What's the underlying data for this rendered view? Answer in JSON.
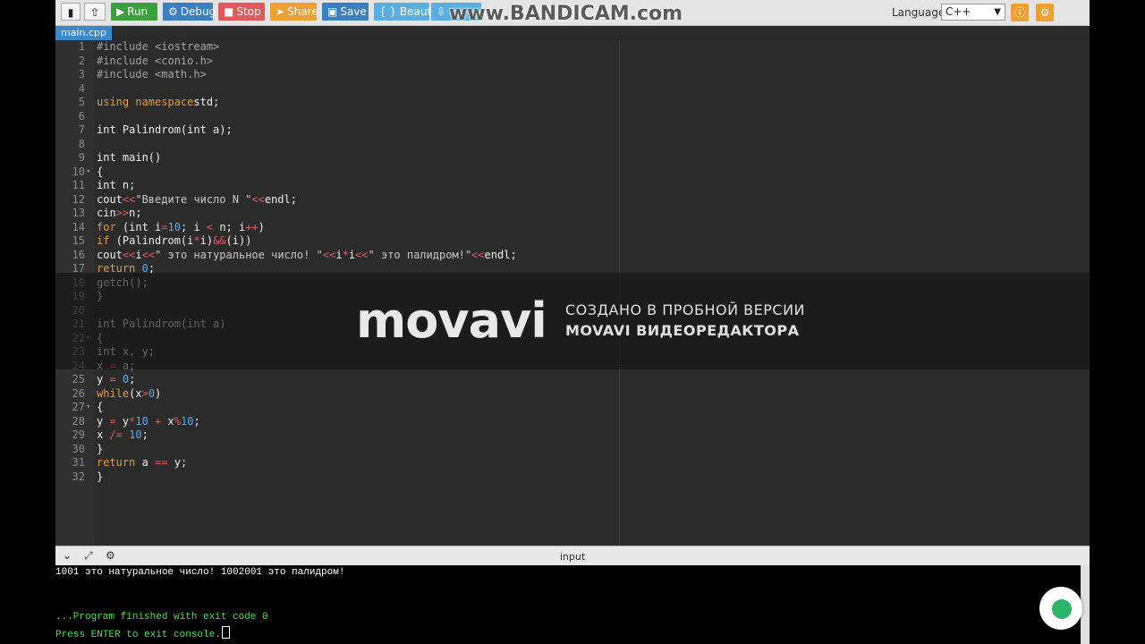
{
  "toolbar": {
    "run": "Run",
    "debug": "Debug",
    "stop": "Stop",
    "share": "Share",
    "save": "Save",
    "beautify": "{ } Beautify",
    "language_label": "Language",
    "language_value": "C++",
    "watermark": "www.BANDICAM.com"
  },
  "tabs": [
    {
      "label": "main.cpp"
    }
  ],
  "editor": {
    "line_numbers": [
      "1",
      "2",
      "3",
      "4",
      "5",
      "6",
      "7",
      "8",
      "9",
      "10",
      "11",
      "12",
      "13",
      "14",
      "15",
      "16",
      "17",
      "18",
      "19",
      "20",
      "21",
      "22",
      "23",
      "24",
      "25",
      "26",
      "27",
      "28",
      "29",
      "30",
      "31",
      "32"
    ]
  },
  "overlay": {
    "logo": "movavi",
    "line1": "СОЗДАНО В ПРОБНОЙ ВЕРСИИ",
    "line2": "MOVAVI ВИДЕОРЕДАКТОРА"
  },
  "io": {
    "label": "input"
  },
  "console": {
    "line1": "1001 это натуральное число! 1002001 это палидром!",
    "line2": "...Program finished with exit code 0",
    "line3": "Press ENTER to exit console."
  },
  "colors": {
    "run": "#3ca03c",
    "debug": "#3a7fc0",
    "stop": "#e05a5a",
    "share": "#f0a030",
    "save": "#3a7fc0",
    "beautify": "#5aaee0"
  }
}
